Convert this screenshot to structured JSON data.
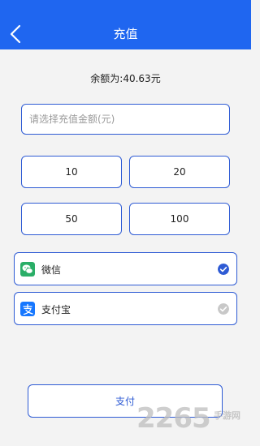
{
  "header": {
    "title": "充值"
  },
  "balance_text": "余额为:40.63元",
  "amount_input": {
    "placeholder": "请选择充值金额(元)",
    "value": ""
  },
  "amount_options": [
    "10",
    "20",
    "50",
    "100"
  ],
  "payment_methods": [
    {
      "label": "微信",
      "icon": "wechat-icon",
      "selected": true
    },
    {
      "label": "支付宝",
      "icon": "alipay-icon",
      "selected": false
    }
  ],
  "submit_label": "支付",
  "watermark": {
    "number": "2265",
    "text": "手游网"
  },
  "colors": {
    "accent": "#1f66f0",
    "border": "#2e5bd4",
    "wechat": "#2aae67",
    "alipay": "#1677ff",
    "check_selected": "#2e5bd4",
    "check_unselected": "#c8c8c8"
  }
}
